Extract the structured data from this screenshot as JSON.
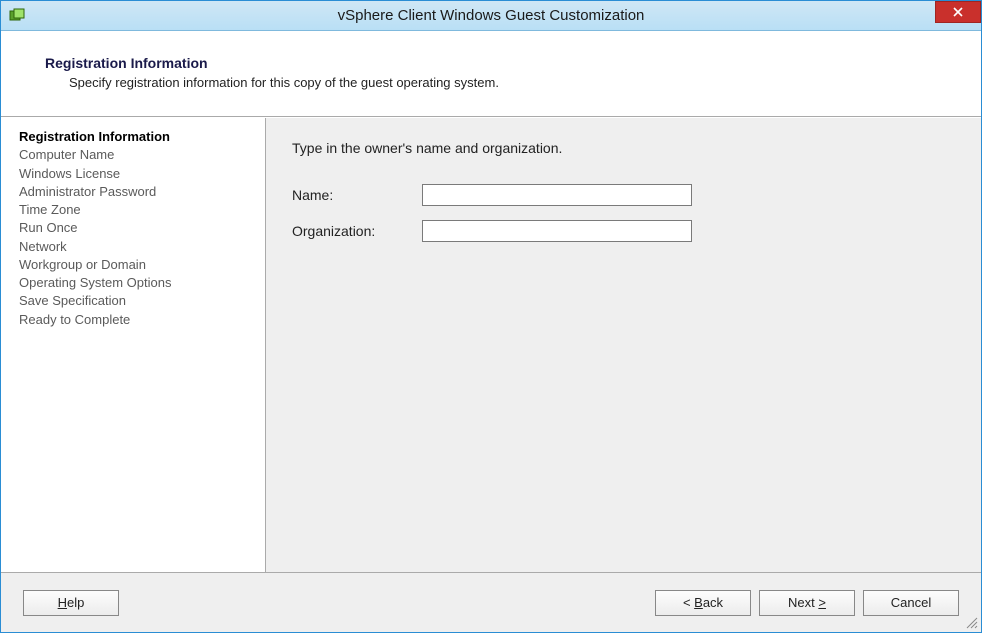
{
  "window": {
    "title": "vSphere Client Windows Guest Customization"
  },
  "header": {
    "title": "Registration Information",
    "subtitle": "Specify registration information for this copy of the guest operating system."
  },
  "sidebar": {
    "items": [
      {
        "label": "Registration Information",
        "active": true
      },
      {
        "label": "Computer Name",
        "active": false
      },
      {
        "label": "Windows License",
        "active": false
      },
      {
        "label": "Administrator Password",
        "active": false
      },
      {
        "label": "Time Zone",
        "active": false
      },
      {
        "label": "Run Once",
        "active": false
      },
      {
        "label": "Network",
        "active": false
      },
      {
        "label": "Workgroup or Domain",
        "active": false
      },
      {
        "label": "Operating System Options",
        "active": false
      },
      {
        "label": "Save Specification",
        "active": false
      },
      {
        "label": "Ready to Complete",
        "active": false
      }
    ]
  },
  "content": {
    "instruction": "Type in the owner's name and organization.",
    "name_label": "Name:",
    "name_value": "",
    "org_label": "Organization:",
    "org_value": ""
  },
  "footer": {
    "help_underline": "H",
    "help_rest": "elp",
    "back_prefix": "< ",
    "back_underline": "B",
    "back_rest": "ack",
    "next_prefix": "Next ",
    "next_underline": ">",
    "next_rest": "",
    "cancel": "Cancel"
  }
}
